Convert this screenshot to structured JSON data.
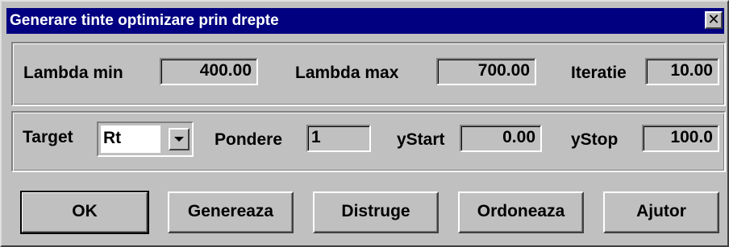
{
  "window": {
    "title": "Generare tinte optimizare prin drepte",
    "close_glyph": "✕"
  },
  "range": {
    "lambda_min_label": "Lambda min",
    "lambda_min_value": "400.00",
    "lambda_max_label": "Lambda max",
    "lambda_max_value": "700.00",
    "iteratie_label": "Iteratie",
    "iteratie_value": "10.00"
  },
  "target": {
    "target_label": "Target",
    "target_selected": "Rt",
    "pondere_label": "Pondere",
    "pondere_value": "1",
    "ystart_label": "yStart",
    "ystart_value": "0.00",
    "ystop_label": "yStop",
    "ystop_value": "100.0"
  },
  "buttons": {
    "ok": "OK",
    "genereaza": "Genereaza",
    "distruge": "Distruge",
    "ordoneaza": "Ordoneaza",
    "ajutor": "Ajutor"
  },
  "colors": {
    "face": "#c0c0c0",
    "title_bar": "#000080",
    "title_text": "#ffffff"
  }
}
